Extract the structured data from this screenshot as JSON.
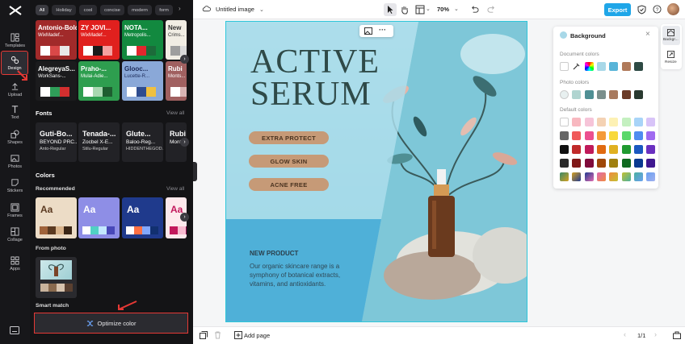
{
  "rail": {
    "items": [
      {
        "label": "Templates"
      },
      {
        "label": "Design"
      },
      {
        "label": "Upload"
      },
      {
        "label": "Text"
      },
      {
        "label": "Shapes"
      },
      {
        "label": "Photos"
      },
      {
        "label": "Stickers"
      },
      {
        "label": "Frames"
      },
      {
        "label": "Collage"
      },
      {
        "label": "Apps"
      }
    ]
  },
  "panel": {
    "chips": [
      "All",
      "Holiday",
      "cool",
      "concise",
      "modern",
      "form"
    ],
    "templates_row1": [
      {
        "t1": "Antonio-Bold",
        "t2": "WixMadef...",
        "bg": "#a12a2a",
        "fg": "#ffffff",
        "sw": [
          "#ffffff",
          "#d94848",
          "#e8e8e8"
        ]
      },
      {
        "t1": "ZY JOVI...",
        "t2": "WixMadef...",
        "bg": "#e0201e",
        "fg": "#ffffff",
        "sw": [
          "#ffffff",
          "#1a1a1a",
          "#f5a0a0"
        ]
      },
      {
        "t1": "NOTA...",
        "t2": "Metropolis...",
        "bg": "#12893f",
        "fg": "#ffffff",
        "sw": [
          "#ffffff",
          "#e3262d",
          "#1c6b3a"
        ]
      },
      {
        "t1": "New",
        "t2": "Crims...",
        "bg": "#f1ede4",
        "fg": "#333333",
        "sw": [
          "#9e9e9e",
          "#d9d9d9",
          "#555555"
        ]
      }
    ],
    "templates_row2": [
      {
        "t1": "AlegreyaS...",
        "t2": "WorkSans-...",
        "bg": "#1b1b1d",
        "fg": "#ffffff",
        "sw": [
          "#ffffff",
          "#2f9e59",
          "#d32f2f"
        ]
      },
      {
        "t1": "Praho-...",
        "t2": "Mulai-Adie...",
        "bg": "#2e9e4f",
        "fg": "#ffffff",
        "sw": [
          "#ffffff",
          "#a8d8b0",
          "#1e5e30"
        ]
      },
      {
        "t1": "Glooc...",
        "t2": "Lucette-R...",
        "bg": "#8aa8d8",
        "fg": "#1d2c5a",
        "sw": [
          "#ffffff",
          "#2f4c8f",
          "#f0c040"
        ]
      },
      {
        "t1": "Rubi",
        "t2": "Monts...",
        "bg": "#a06060",
        "fg": "#ffffff",
        "sw": [
          "#ffffff",
          "#d9b4b4",
          "#5a2a2a"
        ]
      }
    ],
    "fonts_title": "Fonts",
    "fonts_viewall": "View all",
    "fonts": [
      {
        "a": "Guti-Bo...",
        "b": "BEYOND PRC...",
        "c": "Anto-Regular"
      },
      {
        "a": "Tenada-...",
        "b": "Zocbel X-E...",
        "c": "Stilu-Regular"
      },
      {
        "a": "Glute...",
        "b": "Baloo-Reg...",
        "c": "HIDDENTHEGOD..."
      },
      {
        "a": "Rubi",
        "b": "Mont...",
        "c": ""
      }
    ],
    "colors_title": "Colors",
    "recommended_label": "Recommended",
    "colors_viewall": "View all",
    "color_tiles": [
      {
        "aa": "Aa",
        "bg": "#ecdcc6",
        "fg": "#5b3a21",
        "row": [
          "#a0633a",
          "#5b3a21",
          "#d9b48c",
          "#3a2616"
        ]
      },
      {
        "aa": "Aa",
        "bg": "#8e8ee6",
        "fg": "#ffffff",
        "row": [
          "#ffffff",
          "#51d0c4",
          "#c3e8ff",
          "#4848b8"
        ]
      },
      {
        "aa": "Aa",
        "bg": "#1f3a8c",
        "fg": "#ffffff",
        "row": [
          "#ffffff",
          "#ff7043",
          "#82a8ff",
          "#123070"
        ]
      },
      {
        "aa": "Aa",
        "bg": "#fde9ec",
        "fg": "#c2185b",
        "row": [
          "#c2185b",
          "#f8bbd0",
          "#880e4f",
          "#f48fb1"
        ]
      }
    ],
    "from_photo_label": "From photo",
    "from_photo_swatches": [
      "#c9b39c",
      "#8a6a4e",
      "#d7c3ad",
      "#5a4030"
    ],
    "smart_match_label": "Smart match",
    "optimize_label": "Optimize color"
  },
  "topbar": {
    "doc_title": "Untitled image",
    "zoom": "70%",
    "export_label": "Export"
  },
  "canvas": {
    "title_line1": "ACTIVE",
    "title_line2": "SERUM",
    "pills": [
      "EXTRA PROTECT",
      "GLOW SKIN",
      "ACNE FREE"
    ],
    "new_product": "NEW PRODUCT",
    "desc_line1": "Our organic skincare range is a",
    "desc_line2": "symphony of botanical extracts,",
    "desc_line3": "vitamins, and antioxidants."
  },
  "bg_panel": {
    "title": "Background",
    "doc_colors_label": "Document colors",
    "doc_colors": [
      "#ffffff",
      "#a8d8e8",
      "#58b4d8",
      "#b07a5a",
      "#2e4a44"
    ],
    "photo_colors_label": "Photo colors",
    "photo_colors": [
      "#b0d4d0",
      "#4f8f94",
      "#7a8f8c",
      "#a87a5e",
      "#6a3a26",
      "#2a3a30"
    ],
    "default_colors_label": "Default colors",
    "default_colors": [
      "#ffffff",
      "#f8b8c0",
      "#f6c4d8",
      "#f4d2b4",
      "#fdf1b4",
      "#c4f0c0",
      "#a8d4f8",
      "#d8c4f8",
      "#666666",
      "#f05a5a",
      "#ec4f8f",
      "#f49a3a",
      "#f8d83a",
      "#5ad86a",
      "#4f8cf0",
      "#a06af0",
      "#111111",
      "#c02a2a",
      "#c01a5a",
      "#e06a10",
      "#e0b020",
      "#209a30",
      "#1a58c0",
      "#6a30c0",
      "#2a2a2a",
      "#801818",
      "#800a3a",
      "#a04808",
      "#a08010",
      "#106a20",
      "#0a3a90",
      "#401890"
    ],
    "gradient_colors": [
      "#3a8a6a",
      "#d4a020",
      "#203a90",
      "#e06ab0",
      "#f08a40",
      "#c4c030",
      "#4ab0a0",
      "#6aa0f0",
      "#a0b0f0"
    ]
  },
  "rightrail": {
    "bg_label": "Backgr...",
    "resize_label": "Resize"
  },
  "bottombar": {
    "add_page_label": "Add page",
    "page_counter": "1/1"
  }
}
